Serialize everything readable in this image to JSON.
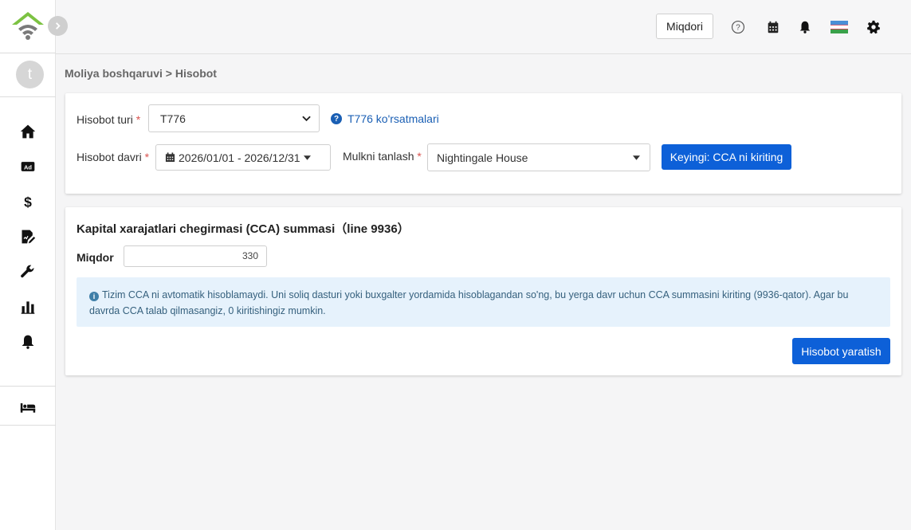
{
  "header": {
    "quantity_button": "Miqdori",
    "icons": [
      "help-icon",
      "calendar-icon",
      "bell-icon",
      "flag-icon",
      "gear-icon"
    ]
  },
  "sidebar": {
    "avatar_letter": "t",
    "items": [
      {
        "icon": "home-icon"
      },
      {
        "icon": "ad-icon"
      },
      {
        "icon": "dollar-icon"
      },
      {
        "icon": "document-edit-icon"
      },
      {
        "icon": "wrench-icon"
      },
      {
        "icon": "bar-chart-icon"
      },
      {
        "icon": "bell-icon"
      },
      {
        "icon": "bed-icon"
      }
    ]
  },
  "breadcrumb": "Moliya boshqaruvi > Hisobot",
  "form": {
    "report_type_label": "Hisobot turi",
    "report_type_value": "T776",
    "guide_link": "T776 ko'rsatmalari",
    "report_period_label": "Hisobot davri",
    "report_period_value": "2026/01/01 - 2026/12/31",
    "property_label": "Mulkni tanlash",
    "property_value": "Nightingale House",
    "next_button": "Keyingi: CCA ni kiriting",
    "required_mark": "*"
  },
  "cca": {
    "title": "Kapital xarajatlari chegirmasi (CCA) summasi（line 9936）",
    "amount_label": "Miqdor",
    "amount_value": "330",
    "info_text": "Tizim CCA ni avtomatik hisoblamaydi. Uni soliq dasturi yoki buxgalter yordamida hisoblagandan so'ng, bu yerga davr uchun CCA summasini kiriting (9936-qator). Agar bu davrda CCA talab qilmasangiz, 0 kiritishingiz mumkin.",
    "generate_button": "Hisobot yaratish"
  },
  "colors": {
    "primary": "#0d60d8",
    "link": "#1a5fb4",
    "info_bg": "#e6f2fc",
    "logo_green": "#7cc242",
    "required": "#d9534f"
  }
}
